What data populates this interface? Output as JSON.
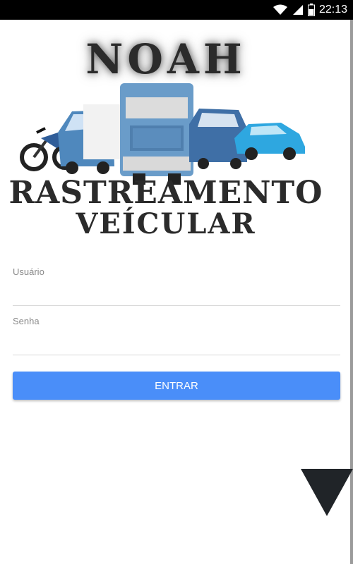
{
  "status_bar": {
    "time": "22:13",
    "icons": [
      "wifi-icon",
      "signal-icon",
      "battery-icon"
    ]
  },
  "logo": {
    "title": "NOAH",
    "subtitle_line1": "RASTREAMENTO",
    "subtitle_line2": "VEÍCULAR"
  },
  "form": {
    "username_label": "Usuário",
    "username_value": "",
    "password_label": "Senha",
    "password_value": "",
    "submit_label": "ENTRAR"
  },
  "colors": {
    "accent": "#4a8ef9",
    "status_bar": "#000000",
    "logo_text": "#2b2b2b"
  },
  "scroll_indicator": {
    "icon": "triangle-down-icon"
  }
}
